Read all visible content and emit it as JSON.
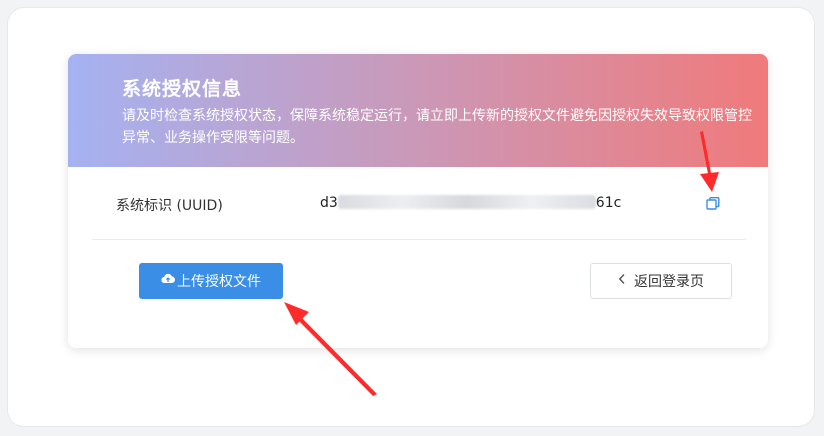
{
  "card": {
    "title": "系统授权信息",
    "description": "请及时检查系统授权状态，保障系统稳定运行，请立即上传新的授权文件避免因授权失效导致权限管控异常、业务操作受限等问题。"
  },
  "uuid_row": {
    "label": "系统标识 (UUID)",
    "value_prefix": "d3",
    "value_suffix": "61c",
    "copy_icon": "copy-icon"
  },
  "actions": {
    "upload_label": "上传授权文件",
    "upload_icon": "cloud-upload-icon",
    "back_label": "返回登录页",
    "back_icon": "chevron-left-icon"
  },
  "colors": {
    "header_gradient_start": "#a5b2f2",
    "header_gradient_end": "#f07a7b",
    "primary": "#3a8ee6",
    "annotation_arrow": "#ff2a2a"
  }
}
